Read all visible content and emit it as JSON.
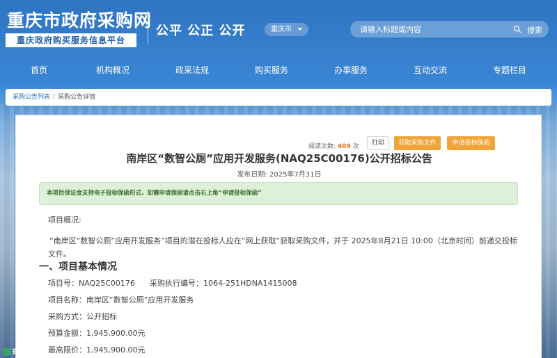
{
  "header": {
    "site_title": "重庆市政府采购网",
    "site_subtitle": "重庆政府购买服务信息平台",
    "slogan": "公平 公正 公开",
    "region": "重庆市",
    "search_placeholder": "请输入标题或内容",
    "search_label": "搜索"
  },
  "nav": {
    "items": [
      "首页",
      "机构概况",
      "政采法规",
      "购买服务",
      "办事服务",
      "互动交流",
      "专题栏目"
    ]
  },
  "breadcrumb": {
    "parent": "采购公告列表",
    "separator": "/",
    "current": "采购公告详情"
  },
  "article": {
    "read_label": "阅读次数:",
    "read_count": "409",
    "read_unit": "次",
    "print_label": "打印",
    "get_docs_label": "获取采购文件",
    "guarantee_label": "申请投标保函",
    "title": "南岸区“数智公厕”应用开发服务(NAQ25C00176)公开招标公告",
    "publish_label": "发布日期:",
    "publish_date": "2025年7月31日",
    "notice": "本项目保证金支持电子投标保函形式，如需申请保函请点击右上角“申请投标保函”",
    "overview_label": "项目概况:",
    "overview_text": "“南岸区“数智公厕”应用开发服务”项目的潜在投标人应在“网上获取”获取采购文件，并于 2025年8月21日 10:00（北京时间）前递交投标文件。",
    "section1_title": "一、项目基本情况",
    "project_no": "项目号：NAQ25C00176",
    "exec_no": "采购执行编号：1064-251HDNA1415008",
    "project_name": "项目名称：南岸区“数智公厕”应用开发服务",
    "method": "采购方式：公开招标",
    "budget": "预算金额：1,945,900.00元",
    "max_price": "最高限价：1,945,900.00元"
  },
  "watermark": {
    "text": "环卫科技网"
  }
}
